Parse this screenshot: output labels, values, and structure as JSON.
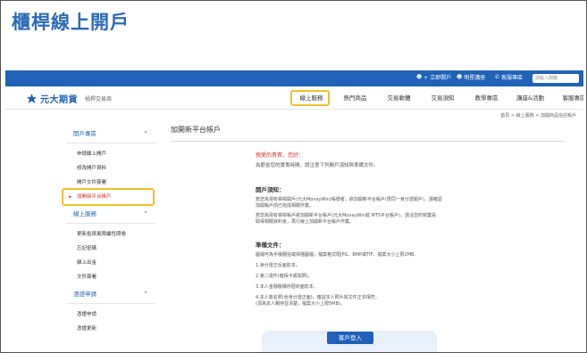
{
  "slide_title": "櫃桿線上開戶",
  "topbar": {
    "items": [
      {
        "icon": "add-user-icon",
        "label": "+ 立即開戶"
      },
      {
        "icon": "user-icon",
        "label": "明星講座"
      },
      {
        "icon": "phone-icon",
        "label": "客服專區"
      }
    ],
    "search_placeholder": "請輸入關鍵"
  },
  "header": {
    "logo_name": "元大期貨",
    "logo_sub": "槓桿交易商",
    "nav": [
      {
        "label": "線上服務",
        "active": true
      },
      {
        "label": "熱門商品",
        "active": false
      },
      {
        "label": "交易軟體",
        "active": false
      },
      {
        "label": "交易須知",
        "active": false
      },
      {
        "label": "教學專區",
        "active": false
      },
      {
        "label": "講座&活動",
        "active": false
      },
      {
        "label": "客服專區",
        "active": false
      }
    ]
  },
  "breadcrumb": "首頁 > 線上服務 > 加開商品信託帳戶",
  "sidebar": {
    "groups": [
      {
        "title": "開戶專區",
        "items": [
          {
            "label": "申請線上開戶",
            "current": false
          },
          {
            "label": "修改開戶資料",
            "current": false
          },
          {
            "label": "開戶文件簽署",
            "current": false
          },
          {
            "label": "加開新平台帳戶",
            "current": true
          }
        ]
      },
      {
        "title": "線上服務",
        "items": [
          {
            "label": "更新投資風險屬性問卷",
            "current": false
          },
          {
            "label": "忘記密碼",
            "current": false
          },
          {
            "label": "線上出金",
            "current": false
          },
          {
            "label": "文件簽署",
            "current": false
          }
        ]
      },
      {
        "title": "憑證申請",
        "items": [
          {
            "label": "憑證申請",
            "current": false
          },
          {
            "label": "憑證更新",
            "current": false
          }
        ]
      }
    ]
  },
  "content": {
    "title": "加開新平台帳戶",
    "greeting": "親愛的貴賓，您好：",
    "intro": "為節省您的寶貴時間，請注意下列開戶須知與準備文件。",
    "notice_title": "開戶須知：",
    "notice_lines": [
      "若您為現有槓桿開戶(元大MoneyWin)帳號者，欲加開新平台帳戶(限同一身分證開戶)，請確認",
      "加開帳戶前已完成相關作業。",
      "若您為現有槓桿帳戶欲加開新平台帳戶(元大MoneyWin或 MT5平台帳戶)，請洽您的營業員",
      "取得相關資料後，再行線上加開新平台帳戶作業。"
    ],
    "docs_title": "準備文件：",
    "docs_lines": [
      "圖檔可為手機翻拍或掃描圖檔，檔案格式限JPG、BMP或TIF，檔案大小上限2MB。",
      "1.身分證正反面影本。",
      "2.第二證件(健保卡或駕照)。",
      "3.本人金融機構存摺封面影本。",
      "4.本人簽名照(含身分證正面)，確認本人照片與文件正本相符。",
      "  (須為本人親持並清楚，檔案大小上限5MB)。"
    ],
    "login_label": "客戶登入"
  }
}
